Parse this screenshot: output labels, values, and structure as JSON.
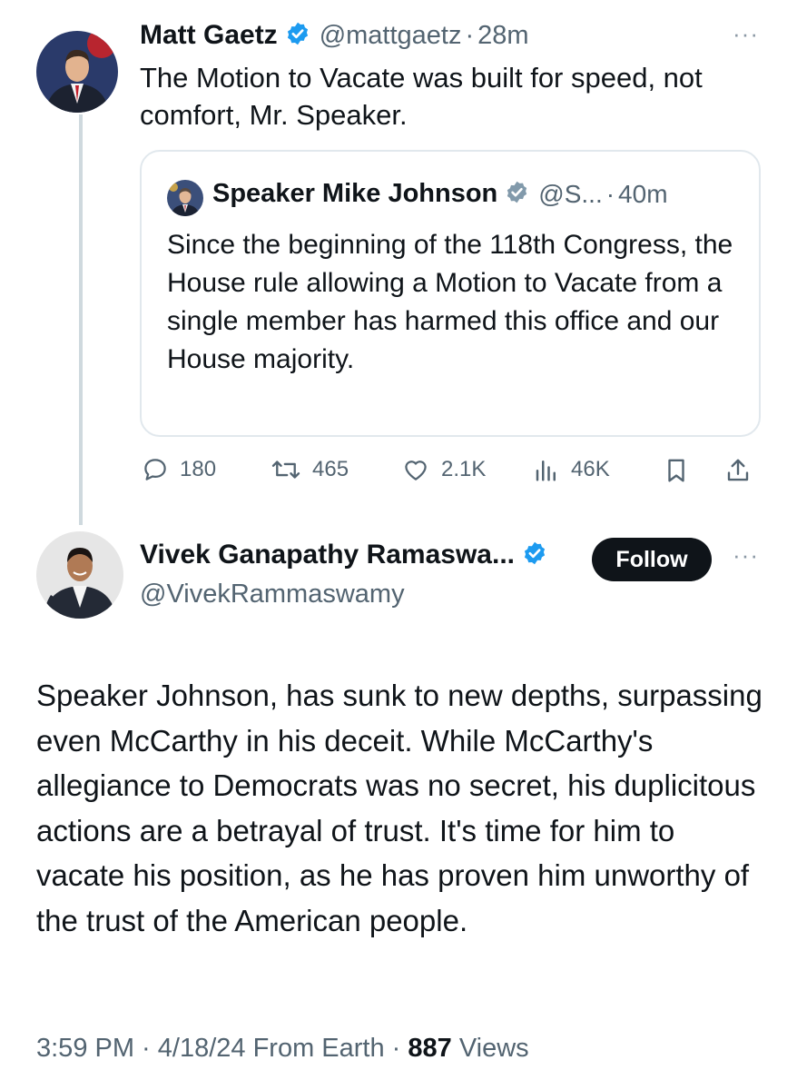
{
  "tweet": {
    "author_name": "Matt Gaetz",
    "handle": "@mattgaetz",
    "separator": "·",
    "time": "28m",
    "more": "···",
    "text": "The Motion to Vacate was built for speed, not comfort, Mr. Speaker.",
    "quote": {
      "author_name": "Speaker Mike Johnson",
      "handle": "@S...",
      "separator": "·",
      "time": "40m",
      "text": "Since the beginning of the 118th Congress, the House rule allowing a Motion to Vacate from a single member has harmed this office and our House majority."
    },
    "actions": {
      "replies": "180",
      "reposts": "465",
      "likes": "2.1K",
      "views": "46K"
    }
  },
  "reply": {
    "author_name": "Vivek Ganapathy Ramaswa...",
    "handle": "@VivekRammaswamy",
    "follow_label": "Follow",
    "more": "···",
    "text": "Speaker Johnson, has sunk to new depths, surpassing even McCarthy in his deceit. While McCarthy's allegiance to Democrats was no secret, his duplicitous actions are a betrayal of trust. It's time for him to vacate his position, as he has proven him unworthy of the trust of the American people.",
    "meta_time": "3:59 PM · 4/18/24 From Earth · ",
    "meta_views_count": "887",
    "meta_views_label": " Views"
  },
  "colors": {
    "verified": "#1d9bf0",
    "secondary_text": "#536471",
    "border": "#e1e8ed"
  },
  "icons": [
    "verified-badge-icon",
    "reply-icon",
    "repost-icon",
    "like-icon",
    "views-icon",
    "bookmark-icon",
    "share-icon",
    "more-icon"
  ]
}
